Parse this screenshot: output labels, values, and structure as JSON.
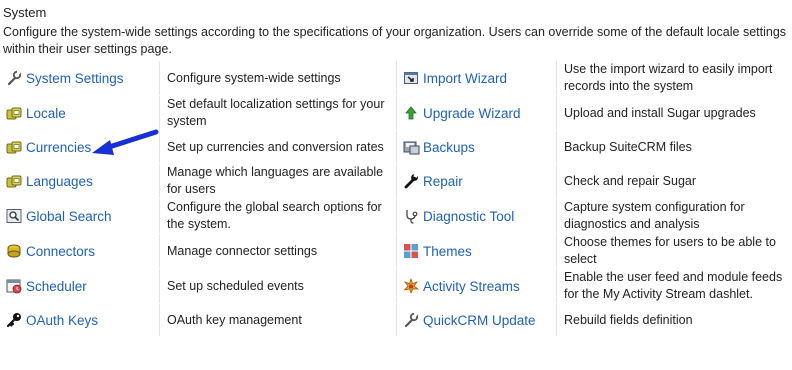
{
  "section": {
    "title": "System",
    "description": "Configure the system-wide settings according to the specifications of your organization. Users can override some of the default locale settings within their user settings page."
  },
  "rows": [
    {
      "left": {
        "label": "System Settings",
        "icon": "wrench-icon",
        "desc": "Configure system-wide settings"
      },
      "right": {
        "label": "Import Wizard",
        "icon": "import-icon",
        "desc": "Use the import wizard to easily import records into the system"
      }
    },
    {
      "left": {
        "label": "Locale",
        "icon": "locale-icon",
        "desc": "Set default localization settings for your system"
      },
      "right": {
        "label": "Upgrade Wizard",
        "icon": "upgrade-arrow-icon",
        "desc": "Upload and install Sugar upgrades"
      }
    },
    {
      "left": {
        "label": "Currencies",
        "icon": "currency-icon",
        "desc": "Set up currencies and conversion rates"
      },
      "right": {
        "label": "Backups",
        "icon": "backup-icon",
        "desc": "Backup SuiteCRM files"
      }
    },
    {
      "left": {
        "label": "Languages",
        "icon": "languages-icon",
        "desc": "Manage which languages are available for users"
      },
      "right": {
        "label": "Repair",
        "icon": "repair-wrench-icon",
        "desc": "Check and repair Sugar"
      }
    },
    {
      "left": {
        "label": "Global Search",
        "icon": "global-search-icon",
        "desc": "Configure the global search options for the system."
      },
      "right": {
        "label": "Diagnostic Tool",
        "icon": "stethoscope-icon",
        "desc": "Capture system configuration for diagnostics and analysis"
      }
    },
    {
      "left": {
        "label": "Connectors",
        "icon": "connectors-icon",
        "desc": "Manage connector settings"
      },
      "right": {
        "label": "Themes",
        "icon": "themes-icon",
        "desc": "Choose themes for users to be able to select"
      }
    },
    {
      "left": {
        "label": "Scheduler",
        "icon": "scheduler-icon",
        "desc": "Set up scheduled events"
      },
      "right": {
        "label": "Activity Streams",
        "icon": "activity-streams-icon",
        "desc": "Enable the user feed and module feeds for the My Activity Stream dashlet."
      }
    },
    {
      "left": {
        "label": "OAuth Keys",
        "icon": "key-icon",
        "desc": "OAuth key management"
      },
      "right": {
        "label": "QuickCRM Update",
        "icon": "quickcrm-wrench-icon",
        "desc": "Rebuild fields definition"
      }
    }
  ],
  "colors": {
    "link": "#1f61b2",
    "text": "#222222",
    "pointer_arrow": "#1a2fd6"
  }
}
